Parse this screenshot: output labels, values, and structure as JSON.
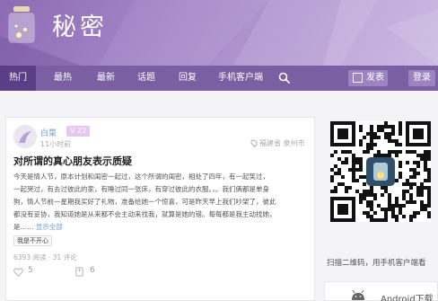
{
  "header": {
    "site_title": "秘密",
    "logo_icon": "glowing-jar-logo-icon"
  },
  "nav": {
    "items": [
      {
        "label": "热门",
        "active": true
      },
      {
        "label": "最热",
        "active": false
      },
      {
        "label": "最新",
        "active": false
      },
      {
        "label": "话题",
        "active": false
      },
      {
        "label": "回复",
        "active": false
      },
      {
        "label": "手机客户端",
        "active": false
      }
    ],
    "search_icon": "search-icon",
    "post_label": "发表",
    "post_icon": "edit-icon",
    "login_label": "登录"
  },
  "post": {
    "author": "白菜",
    "badge": "V 22",
    "time": "11小时前",
    "location": "福建省 泉州市",
    "title": "对所谓的真心朋友表示质疑",
    "body_lines": [
      "今天是情人节，原本计划和闺密一起过，这个所谓的闺密，相处了四年，有一起笑过，",
      "一起哭过，有去过彼此的家，有睡过同一张床，有穿过彼此的衣服。，。我们俩都是单身",
      "狗，情人节前一星期我买好了礼物，准备给她一个惊喜，可是昨天早上我们吵架了，彼此",
      "都没有妥协，我知道她是从来都不会主动来找我，就算是她的错。每每都是我主动找她，"
    ],
    "body_last": "是……",
    "more_label": "显示全部",
    "tag": "我是不开心",
    "views": "6393 阅读",
    "comments": "31 评论",
    "likes": "5",
    "likes_icon": "heart-icon",
    "stars": "6",
    "stars_icon": "bookmark-icon"
  },
  "sidebar": {
    "qr_caption": "扫描二维码，用手机客户端看",
    "qr_icon": "qr-code-icon",
    "android_label": "Android下载",
    "android_icon": "android-icon"
  },
  "colors": {
    "banner": "#9b7fc2",
    "nav": "#7a5fa2",
    "nav_active": "#5a3f86",
    "link": "#6f9dc9"
  }
}
